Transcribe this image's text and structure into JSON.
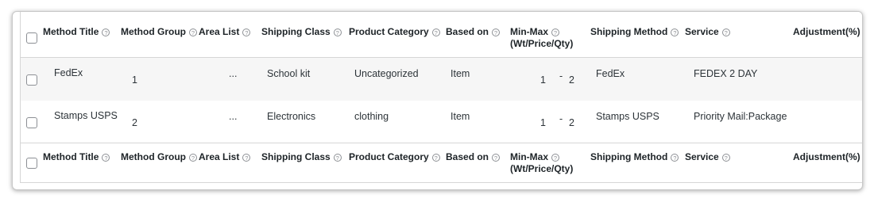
{
  "columns": [
    {
      "label": "Method Title"
    },
    {
      "label": "Method Group"
    },
    {
      "label": "Area List"
    },
    {
      "label": "Shipping Class"
    },
    {
      "label": "Product Category"
    },
    {
      "label": "Based on"
    },
    {
      "label": "Min-Max",
      "sub": "(Wt/Price/Qty)"
    },
    {
      "label": "Shipping Method"
    },
    {
      "label": "Service"
    },
    {
      "label": "Adjustment(%)"
    }
  ],
  "help_glyph": "?",
  "rows": [
    {
      "method_title": "FedEx",
      "method_group": "1",
      "area_list": "...",
      "shipping_class": "School kit",
      "product_category": "Uncategorized",
      "based_on": "Item",
      "min": "1",
      "separator": "-",
      "max": "2",
      "shipping_method": "FedEx",
      "service": "FEDEX 2 DAY",
      "adjustment": ""
    },
    {
      "method_title": "Stamps USPS",
      "method_group": "2",
      "area_list": "...",
      "shipping_class": "Electronics",
      "product_category": "clothing",
      "based_on": "Item",
      "min": "1",
      "separator": "-",
      "max": "2",
      "shipping_method": "Stamps USPS",
      "service": "Priority Mail:Package",
      "adjustment": ""
    }
  ]
}
